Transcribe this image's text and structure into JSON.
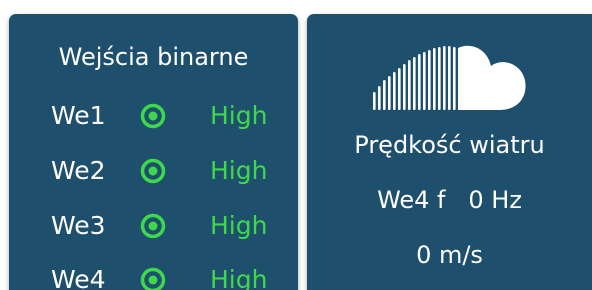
{
  "binary_inputs": {
    "title": "Wejścia binarne",
    "led_color": "#3dd94a",
    "state_color": "#3dd94a",
    "panel_color": "#1e4f6c",
    "rows": [
      {
        "label": "We1",
        "state": "High"
      },
      {
        "label": "We2",
        "state": "High"
      },
      {
        "label": "We3",
        "state": "High"
      },
      {
        "label": "We4",
        "state": "High"
      }
    ]
  },
  "wind": {
    "icon": "soundcloud-cloud-icon",
    "title": "Prędkość wiatru",
    "frequency_line": "We4 f   0 Hz",
    "speed_line": "0 m/s"
  }
}
